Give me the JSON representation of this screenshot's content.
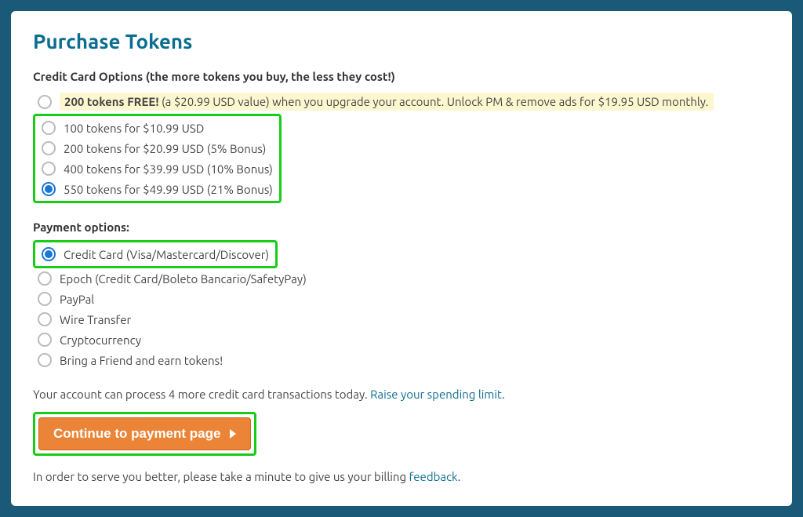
{
  "title": "Purchase Tokens",
  "creditCardSection": {
    "heading": "Credit Card Options (the more tokens you buy, the less they cost!)",
    "freeOption": {
      "bold": "200 tokens FREE!",
      "rest": " (a $20.99 USD value) when you upgrade your account. Unlock PM & remove ads for $19.95 USD monthly."
    },
    "options": [
      "100 tokens for $10.99 USD",
      "200 tokens for $20.99 USD (5% Bonus)",
      "400 tokens for $39.99 USD (10% Bonus)",
      "550 tokens for $49.99 USD (21% Bonus)"
    ]
  },
  "paymentSection": {
    "heading": "Payment options:",
    "selected": "Credit Card (Visa/Mastercard/Discover)",
    "others": [
      "Epoch (Credit Card/Boleto Bancario/SafetyPay)",
      "PayPal",
      "Wire Transfer",
      "Cryptocurrency",
      "Bring a Friend and earn tokens!"
    ]
  },
  "txn": {
    "prefix": "Your account can process 4 more credit card transactions today. ",
    "link": "Raise your spending limit",
    "suffix": "."
  },
  "button": "Continue to payment page",
  "footer": {
    "prefix": "In order to serve you better, please take a minute to give us your billing ",
    "link": "feedback",
    "suffix": "."
  }
}
